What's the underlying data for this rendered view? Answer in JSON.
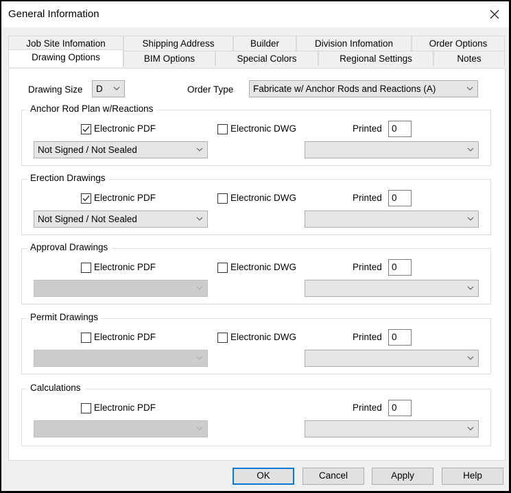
{
  "window": {
    "title": "General Information",
    "close_icon": "close-icon"
  },
  "tabs": {
    "row_top": [
      {
        "label": "Job Site Infomation"
      },
      {
        "label": "Shipping Address"
      },
      {
        "label": "Builder"
      },
      {
        "label": "Division Infomation"
      },
      {
        "label": "Order Options"
      }
    ],
    "row_bottom": [
      {
        "label": "Drawing Options",
        "active": true
      },
      {
        "label": "BIM Options"
      },
      {
        "label": "Special Colors"
      },
      {
        "label": "Regional Settings"
      },
      {
        "label": "Notes"
      }
    ]
  },
  "drawing_size": {
    "label": "Drawing Size",
    "value": "D"
  },
  "order_type": {
    "label": "Order Type",
    "value": "Fabricate w/ Anchor Rods and Reactions (A)"
  },
  "groups": [
    {
      "title": "Anchor Rod Plan w/Reactions",
      "pdf_label": "Electronic PDF",
      "pdf_checked": true,
      "dwg_label": "Electronic DWG",
      "dwg_checked": false,
      "printed_label": "Printed",
      "printed_value": "0",
      "seal_value": "Not Signed / Not Sealed",
      "seal_enabled": true,
      "right_value": ""
    },
    {
      "title": "Erection Drawings",
      "pdf_label": "Electronic PDF",
      "pdf_checked": true,
      "dwg_label": "Electronic DWG",
      "dwg_checked": false,
      "printed_label": "Printed",
      "printed_value": "0",
      "seal_value": "Not Signed / Not Sealed",
      "seal_enabled": true,
      "right_value": ""
    },
    {
      "title": "Approval Drawings",
      "pdf_label": "Electronic PDF",
      "pdf_checked": false,
      "dwg_label": "Electronic DWG",
      "dwg_checked": false,
      "printed_label": "Printed",
      "printed_value": "0",
      "seal_value": "",
      "seal_enabled": false,
      "right_value": ""
    },
    {
      "title": "Permit Drawings",
      "pdf_label": "Electronic PDF",
      "pdf_checked": false,
      "dwg_label": "Electronic DWG",
      "dwg_checked": false,
      "printed_label": "Printed",
      "printed_value": "0",
      "seal_value": "",
      "seal_enabled": false,
      "right_value": ""
    },
    {
      "title": "Calculations",
      "pdf_label": "Electronic PDF",
      "pdf_checked": false,
      "printed_label": "Printed",
      "printed_value": "0",
      "seal_value": "",
      "seal_enabled": false,
      "right_value": ""
    }
  ],
  "buttons": {
    "ok": "OK",
    "cancel": "Cancel",
    "apply": "Apply",
    "help": "Help"
  },
  "colors": {
    "accent": "#0078d7",
    "window_bg": "#f0f0f0",
    "panel_bg": "#ffffff",
    "combo_bg": "#e5e5e5",
    "combo_disabled_bg": "#cccccc"
  }
}
